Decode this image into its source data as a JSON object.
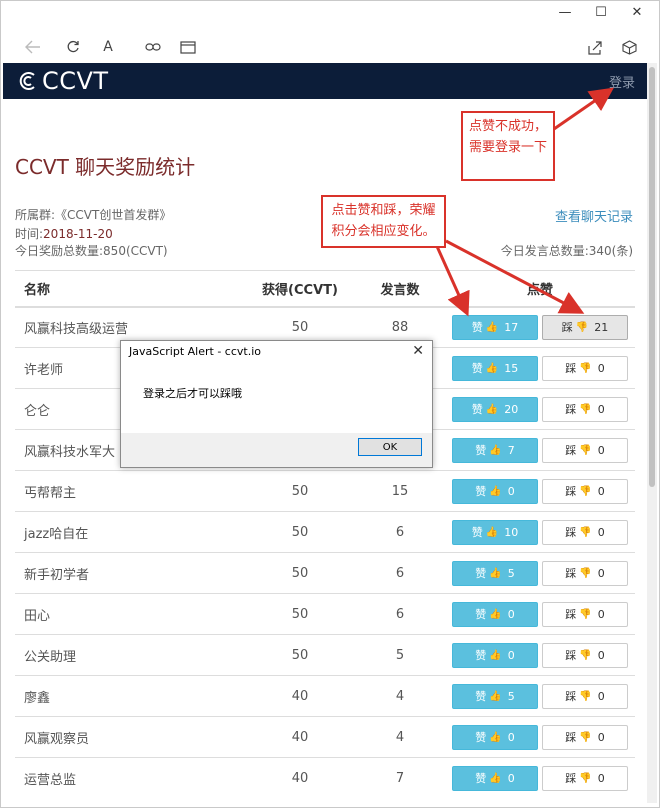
{
  "browser": {
    "window_controls": [
      "—",
      "☐",
      "✕"
    ],
    "toolbar_icons": [
      "back-icon",
      "refresh-icon",
      "reader-icon",
      "link-icon",
      "window-icon",
      "share-icon",
      "cube-icon"
    ],
    "text_icon_label": "A"
  },
  "site": {
    "logo_text": "CCVT",
    "login_label": "登录",
    "header_bg": "#0c1d39"
  },
  "page": {
    "title": "CCVT 聊天奖励统计",
    "group_label": "所属群:《CCVT创世首发群》",
    "time_prefix": "时间:",
    "time_value": "2018-11-20",
    "reward_total_prefix": "今日奖励总数量:",
    "reward_total_value": "850(CCVT)",
    "history_link": "查看聊天记录",
    "msg_total": "今日发言总数量:340(条)"
  },
  "table": {
    "headers": [
      "名称",
      "获得(CCVT)",
      "发言数",
      "点赞"
    ],
    "up_label": "赞",
    "down_label": "踩",
    "rows": [
      {
        "name": "风赢科技高级运营",
        "reward": "50",
        "msgs": "88",
        "up": "17",
        "down": "21"
      },
      {
        "name": "许老师",
        "reward": "",
        "msgs": "",
        "up": "15",
        "down": "0"
      },
      {
        "name": "仑仑",
        "reward": "",
        "msgs": "",
        "up": "20",
        "down": "0"
      },
      {
        "name": "风赢科技水军大",
        "reward": "",
        "msgs": "",
        "up": "7",
        "down": "0"
      },
      {
        "name": "丐帮帮主",
        "reward": "50",
        "msgs": "15",
        "up": "0",
        "down": "0"
      },
      {
        "name": "jazz哈自在",
        "reward": "50",
        "msgs": "6",
        "up": "10",
        "down": "0"
      },
      {
        "name": "新手初学者",
        "reward": "50",
        "msgs": "6",
        "up": "5",
        "down": "0"
      },
      {
        "name": "田心",
        "reward": "50",
        "msgs": "6",
        "up": "0",
        "down": "0"
      },
      {
        "name": "公关助理",
        "reward": "50",
        "msgs": "5",
        "up": "0",
        "down": "0"
      },
      {
        "name": "廖鑫",
        "reward": "40",
        "msgs": "4",
        "up": "5",
        "down": "0"
      },
      {
        "name": "风赢观察员",
        "reward": "40",
        "msgs": "4",
        "up": "0",
        "down": "0"
      },
      {
        "name": "运营总监",
        "reward": "40",
        "msgs": "7",
        "up": "0",
        "down": "0"
      }
    ]
  },
  "annotations": {
    "login_note": "点赞不成功，需要登录一下",
    "vote_note": "点击赞和踩，荣耀积分会相应变化。",
    "color": "#d9322a"
  },
  "dialog": {
    "title": "JavaScript Alert - ccvt.io",
    "message": "登录之后才可以踩哦",
    "ok_label": "OK"
  }
}
